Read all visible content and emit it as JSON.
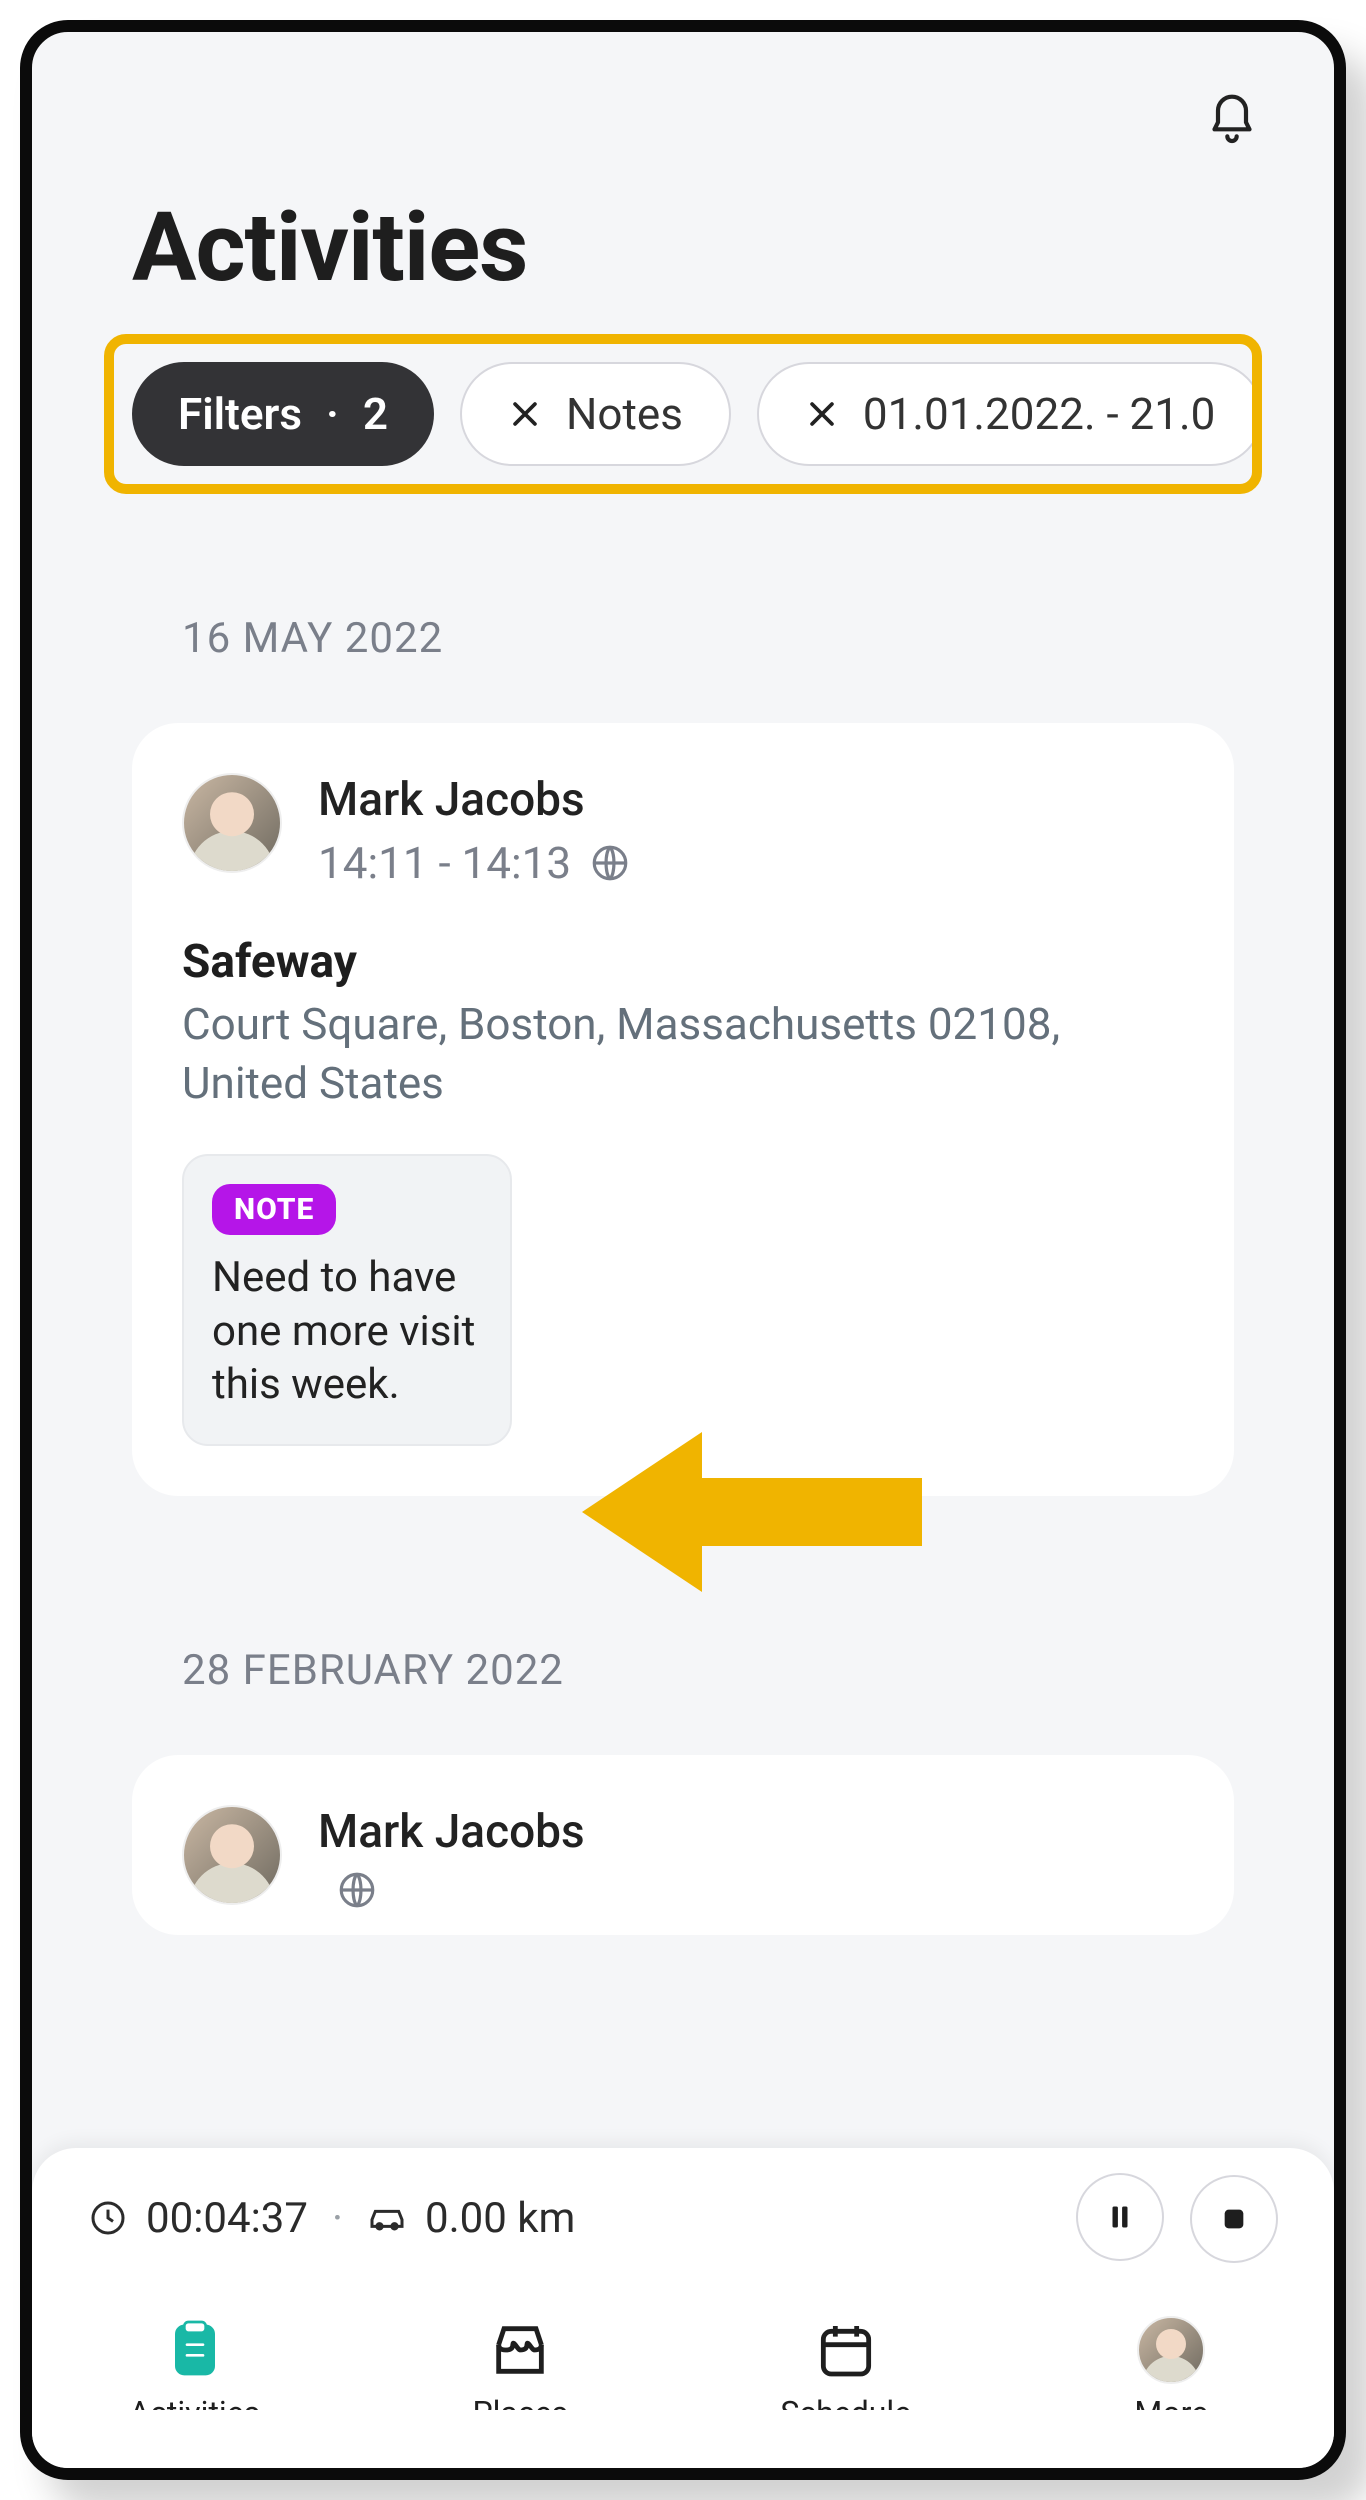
{
  "header": {
    "title": "Activities"
  },
  "filters": {
    "bar_highlighted": true,
    "count_label": "2",
    "filters_label": "Filters",
    "chips": [
      {
        "label": "Notes"
      },
      {
        "label": "01.01.2022. - 21.0"
      }
    ]
  },
  "sections": [
    {
      "date_label": "16 MAY 2022",
      "person": "Mark Jacobs",
      "time": "14:11 - 14:13",
      "place_name": "Safeway",
      "place_address": "Court Square, Boston, Massachusetts 02108, United States",
      "note": {
        "badge": "NOTE",
        "text": "Need to have one more visit this week."
      }
    },
    {
      "date_label": "28 FEBRUARY 2022",
      "person": "Mark Jacobs",
      "time": ""
    }
  ],
  "status": {
    "elapsed": "00:04:37",
    "distance": "0.00 km"
  },
  "nav": {
    "items": [
      {
        "label": "Activities",
        "active": true,
        "icon": "clipboard"
      },
      {
        "label": "Places",
        "icon": "storefront"
      },
      {
        "label": "Schedule",
        "icon": "calendar"
      },
      {
        "label": "More",
        "icon": "avatar"
      }
    ]
  },
  "annotation": {
    "arrow": "left",
    "color": "#f0b400"
  }
}
